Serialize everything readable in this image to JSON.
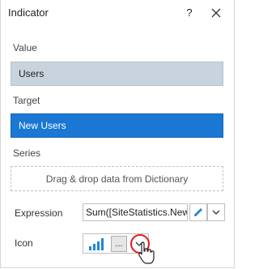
{
  "dialog": {
    "title": "Indicator",
    "help_label": "?"
  },
  "sections": {
    "value_label": "Value",
    "value_field": "Users",
    "target_label": "Target",
    "target_field": "New Users",
    "series_label": "Series",
    "series_drop_text": "Drag & drop data from Dictionary"
  },
  "expression": {
    "label": "Expression",
    "value": "Sum([SiteStatistics.New Users])"
  },
  "icon_row": {
    "label": "Icon",
    "ellipsis_label": "..."
  },
  "colors": {
    "value_bg": "#c9d3de",
    "target_bg": "#1a78d4",
    "accent_icon": "#1e88d6",
    "highlight": "#e01b1b"
  }
}
